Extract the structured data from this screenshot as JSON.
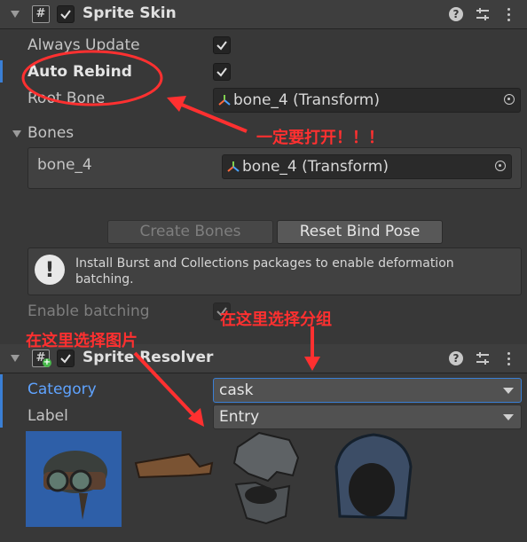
{
  "sprite_skin": {
    "title": "Sprite Skin",
    "enabled": true,
    "script_icon_glyph": "#",
    "fields": {
      "always_update_label": "Always Update",
      "always_update": true,
      "auto_rebind_label": "Auto Rebind",
      "auto_rebind": true,
      "root_bone_label": "Root Bone",
      "root_bone_value": "bone_4 (Transform)"
    },
    "bones": {
      "label": "Bones",
      "items": [
        {
          "name": "bone_4",
          "value": "bone_4 (Transform)"
        }
      ]
    },
    "buttons": {
      "create_bones": "Create Bones",
      "reset_bind_pose": "Reset Bind Pose"
    },
    "info_message": "Install Burst and Collections packages to enable deformation batching.",
    "enable_batching_label": "Enable batching",
    "enable_batching": true
  },
  "sprite_resolver": {
    "title": "Sprite Resolver",
    "enabled": true,
    "script_icon_glyph": "#",
    "category_label": "Category",
    "category_value": "cask",
    "label_label": "Label",
    "label_value": "Entry",
    "thumbnails": [
      "helmet-goggles",
      "leather-strap",
      "iron-helmet",
      "hood"
    ]
  },
  "annotations": {
    "auto_rebind_note": "一定要打开！！！",
    "select_group_note": "在这里选择分组",
    "select_image_note": "在这里选择图片"
  },
  "colors": {
    "background": "#383838",
    "header": "#3e3e3e",
    "annotation": "#ff3030",
    "category_label": "#5fa3ff",
    "selected_thumb": "#2e5fa8",
    "active_bar": "#3a7fd5"
  }
}
